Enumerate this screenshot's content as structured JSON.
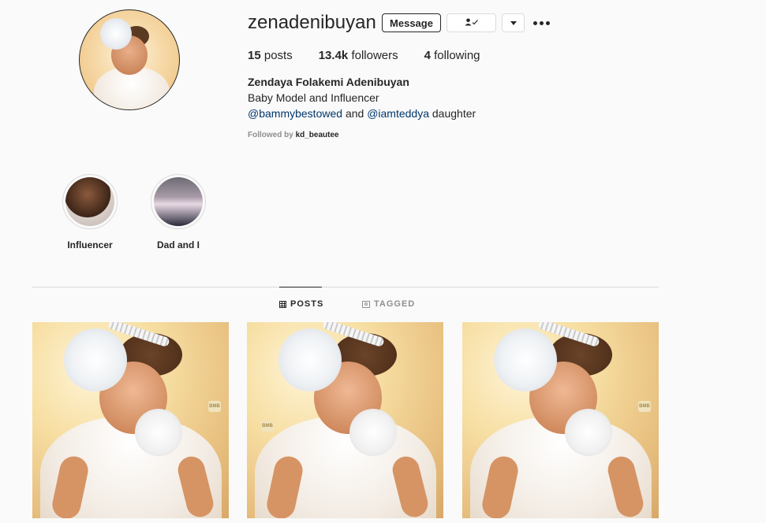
{
  "profile": {
    "username": "zenadenibuyan",
    "message_label": "Message",
    "following_icon": "person-check-icon",
    "dropdown_icon": "caret-down-icon",
    "more_icon": "more-horizontal-icon",
    "stats": {
      "posts_count": "15",
      "posts_label": "posts",
      "followers_count": "13.4k",
      "followers_label": "followers",
      "following_count": "4",
      "following_label": "following"
    },
    "full_name": "Zendaya Folakemi Adenibuyan",
    "bio_line1": "Baby Model and Influencer",
    "bio_mention1": "@bammybestowed",
    "bio_and": "and",
    "bio_mention2": "@iamteddya",
    "bio_suffix": "daughter",
    "followed_by_label": "Followed by",
    "followed_by_user": "kd_beautee"
  },
  "highlights": [
    {
      "label": "Influencer"
    },
    {
      "label": "Dad and I"
    }
  ],
  "tabs": [
    {
      "label": "POSTS",
      "icon": "grid-icon",
      "active": true
    },
    {
      "label": "TAGGED",
      "icon": "tagged-icon",
      "active": false
    }
  ],
  "posts": [
    {
      "watermark": "BMB"
    },
    {
      "watermark": "BMB"
    },
    {
      "watermark": "BMB"
    }
  ],
  "colors": {
    "background": "#fafafa",
    "text": "#262626",
    "link": "#00376b",
    "muted": "#8e8e8e",
    "border": "#dbdbdb"
  }
}
